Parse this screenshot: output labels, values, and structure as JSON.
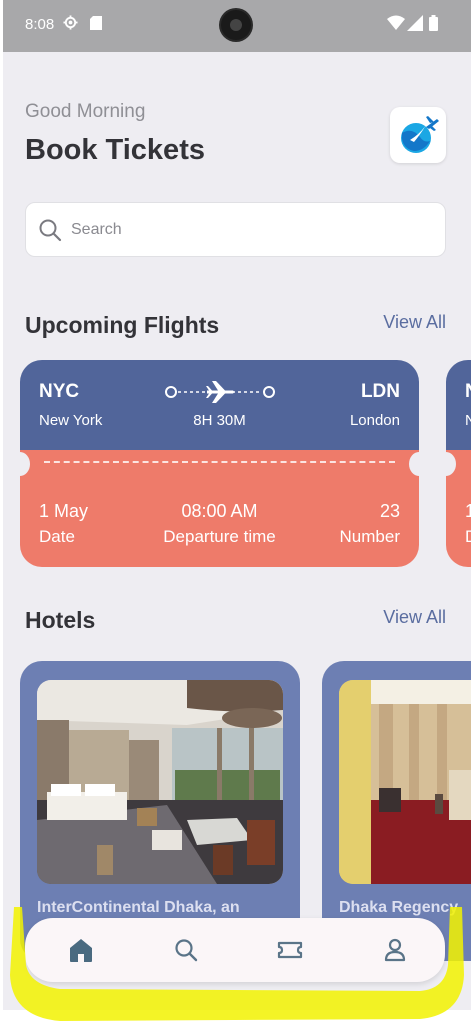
{
  "status_bar": {
    "time": "8:08",
    "icons": [
      "gear-icon",
      "sd-card-icon",
      "camera-cutout",
      "wifi-icon",
      "signal-icon",
      "battery-icon"
    ]
  },
  "header": {
    "greeting": "Good Morning",
    "title": "Book Tickets",
    "logo_icon": "airplane-logo-icon"
  },
  "search": {
    "placeholder": "Search",
    "icon": "search-icon"
  },
  "flights": {
    "section_title": "Upcoming Flights",
    "view_all": "View All",
    "tickets": [
      {
        "from_code": "NYC",
        "from_city": "New York",
        "to_code": "LDN",
        "to_city": "London",
        "duration": "8H 30M",
        "date_value": "1 May",
        "date_label": "Date",
        "time_value": "08:00 AM",
        "time_label": "Departure time",
        "number_value": "23",
        "number_label": "Number"
      },
      {
        "from_code": "N",
        "from_city": "N",
        "to_code": "",
        "to_city": "",
        "duration": "",
        "date_value": "1",
        "date_label": "D",
        "time_value": "",
        "time_label": "",
        "number_value": "",
        "number_label": ""
      }
    ]
  },
  "hotels": {
    "section_title": "Hotels",
    "view_all": "View All",
    "items": [
      {
        "name": "InterContinental Dhaka, an"
      },
      {
        "name": "Dhaka Regency"
      }
    ]
  },
  "bottom_nav": {
    "items": [
      "home-icon",
      "search-icon",
      "ticket-icon",
      "profile-icon"
    ],
    "active": "home-icon"
  },
  "colors": {
    "ticket_top": "#51659a",
    "ticket_bottom": "#ee7b6a",
    "hotel_card": "#6d7fb3",
    "accent_link": "#5a6da0",
    "annotation_highlight": "#f2f200"
  }
}
